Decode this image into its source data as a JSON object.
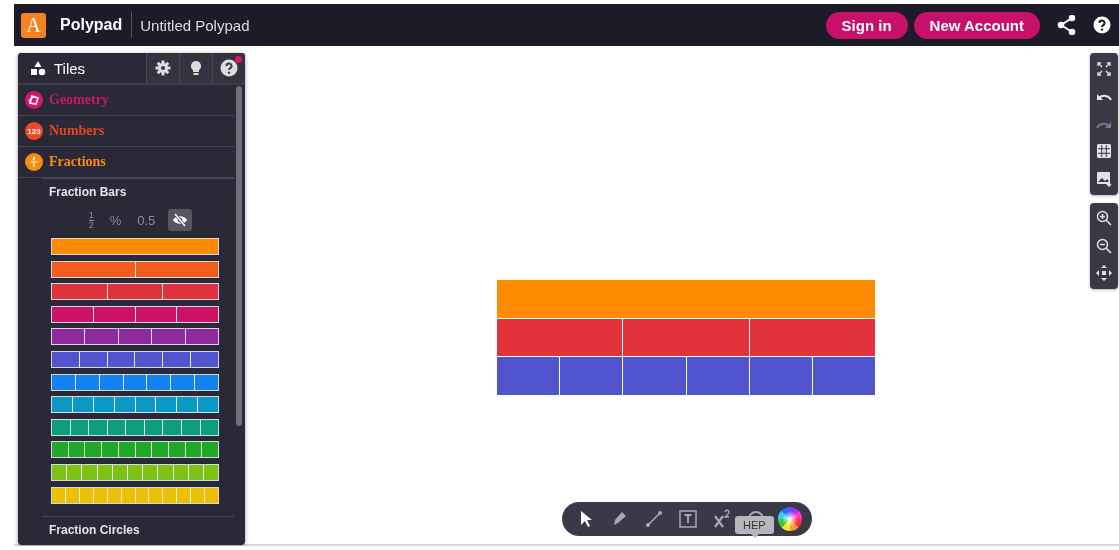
{
  "topbar": {
    "logo": "A",
    "app_name": "Polypad",
    "document_title": "Untitled Polypad",
    "buttons": [
      "Sign in",
      "New Account"
    ]
  },
  "sidebar": {
    "tabs": [
      {
        "kind": "tiles",
        "label": "Tiles"
      },
      {
        "kind": "settings"
      },
      {
        "kind": "hint"
      },
      {
        "kind": "help",
        "notification": true
      }
    ],
    "categories": [
      {
        "label": "Geometry",
        "kind": "geometry",
        "color": "#d6166f",
        "expanded": false
      },
      {
        "label": "Numbers",
        "kind": "numbers",
        "icon_label": "123",
        "color": "#ee4b24",
        "expanded": false
      },
      {
        "label": "Fractions",
        "kind": "fractions",
        "color": "#f98c10",
        "expanded": true,
        "sections": [
          {
            "title": "Fraction Bars",
            "display_options": [
              {
                "kind": "fraction",
                "numerator": "1",
                "denominator": "2",
                "selected": false
              },
              {
                "kind": "text",
                "label": "%",
                "selected": false
              },
              {
                "kind": "text",
                "label": "0.5",
                "selected": false
              },
              {
                "kind": "hide",
                "selected": true
              }
            ],
            "bars": [
              {
                "color": "#ff8c00"
              },
              {
                "color": "#f25c1e"
              },
              {
                "color": "#e0323c"
              },
              {
                "color": "#cc1166"
              },
              {
                "color": "#8e2a9e"
              },
              {
                "color": "#5055cf"
              },
              {
                "color": "#1282ee"
              },
              {
                "color": "#0899c7"
              },
              {
                "color": "#0c9f7b"
              },
              {
                "color": "#22a92a"
              },
              {
                "color": "#7dc316"
              },
              {
                "color": "#ecc003"
              }
            ]
          },
          {
            "title": "Fraction Circles"
          }
        ]
      }
    ]
  },
  "canvas": {
    "rows": [
      {
        "tiles": [
          {
            "color": "#ff8c00"
          }
        ]
      },
      {
        "tiles": [
          {
            "color": "#e0323c"
          },
          {
            "color": "#e0323c"
          },
          {
            "color": "#e0323c"
          }
        ]
      },
      {
        "tiles": [
          {
            "color": "#5055cf"
          },
          {
            "color": "#5055cf"
          },
          {
            "color": "#5055cf"
          },
          {
            "color": "#5055cf"
          },
          {
            "color": "#5055cf"
          },
          {
            "color": "#5055cf"
          }
        ]
      }
    ]
  },
  "right_tools": [
    [
      {
        "kind": "fullscreen",
        "disabled": false
      },
      {
        "kind": "undo",
        "disabled": false
      },
      {
        "kind": "redo",
        "disabled": true
      },
      {
        "kind": "grid",
        "disabled": false
      },
      {
        "kind": "background",
        "disabled": false
      }
    ],
    [
      {
        "kind": "zoom-in",
        "disabled": false
      },
      {
        "kind": "zoom-out",
        "disabled": false
      },
      {
        "kind": "pan",
        "disabled": false
      }
    ]
  ],
  "toolbar": {
    "tools": [
      {
        "kind": "select",
        "selected": true
      },
      {
        "kind": "pen",
        "selected": false
      },
      {
        "kind": "line",
        "selected": false
      },
      {
        "kind": "text",
        "selected": false
      },
      {
        "kind": "equation",
        "selected": false
      },
      {
        "kind": "shape",
        "selected": false
      },
      {
        "kind": "color",
        "selected": false
      }
    ],
    "tooltip": "HEP"
  }
}
